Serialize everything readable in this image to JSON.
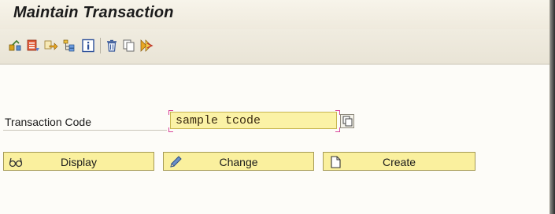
{
  "window": {
    "title": "Maintain Transaction"
  },
  "toolbar": {
    "icons": [
      "transaction-tree-icon",
      "object-list-icon",
      "navigate-icon",
      "hierarchy-icon",
      "info-icon",
      "delete-icon",
      "copy-icon",
      "variants-icon"
    ]
  },
  "form": {
    "transaction_code_label": "Transaction Code",
    "transaction_code_value": "sample tcode"
  },
  "buttons": {
    "display_label": "Display",
    "change_label": "Change",
    "create_label": "Create"
  },
  "colors": {
    "input_background": "#fbf2a6",
    "button_background": "#faf09e",
    "focus_marker": "#d8449a"
  }
}
